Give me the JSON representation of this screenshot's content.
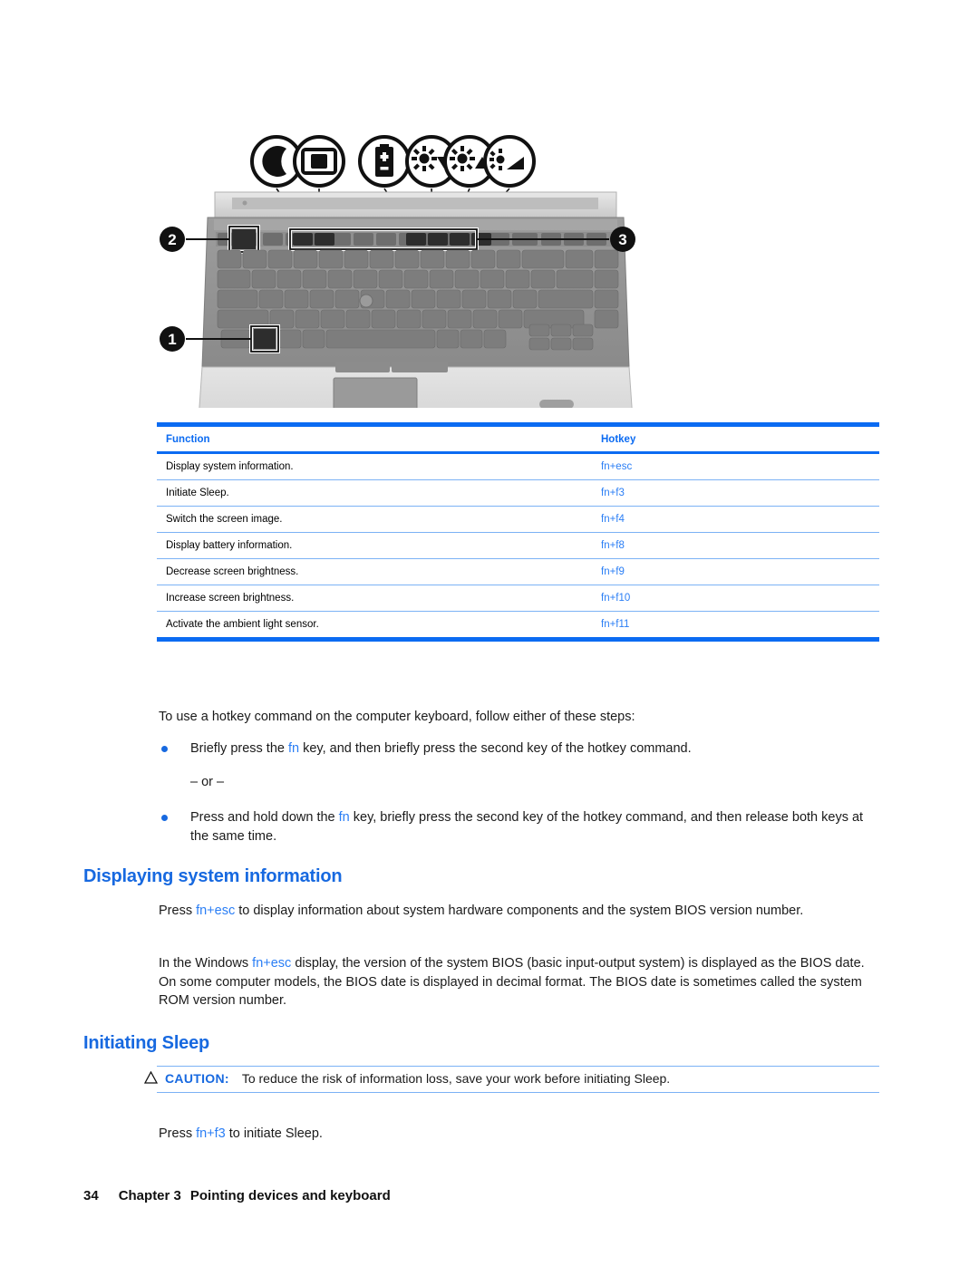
{
  "illustration": {
    "alt": "HP EliteBook notebook top view showing fn key, hotkey function keys and num lock key",
    "callouts": [
      {
        "id": "1",
        "label": "1"
      },
      {
        "id": "2",
        "label": "2"
      },
      {
        "id": "3",
        "label": "3"
      }
    ],
    "icons": [
      {
        "name": "sleep-moon-icon",
        "meaning": "Initiate Sleep"
      },
      {
        "name": "switch-screen-icon",
        "meaning": "Switch the screen image"
      },
      {
        "name": "battery-icon",
        "meaning": "Display battery information"
      },
      {
        "name": "brightness-decrease-icon",
        "meaning": "Decrease screen brightness"
      },
      {
        "name": "brightness-increase-icon",
        "meaning": "Increase screen brightness"
      },
      {
        "name": "ambient-light-sensor-icon",
        "meaning": "Activate the ambient light sensor"
      }
    ]
  },
  "table": {
    "headers": {
      "function": "Function",
      "hotkey": "Hotkey"
    },
    "rows": [
      {
        "function": "Display system information.",
        "hotkey": "fn+esc"
      },
      {
        "function": "Initiate Sleep.",
        "hotkey": "fn+f3"
      },
      {
        "function": "Switch the screen image.",
        "hotkey": "fn+f4"
      },
      {
        "function": "Display battery information.",
        "hotkey": "fn+f8"
      },
      {
        "function": "Decrease screen brightness.",
        "hotkey": "fn+f9"
      },
      {
        "function": "Increase screen brightness.",
        "hotkey": "fn+f10"
      },
      {
        "function": "Activate the ambient light sensor.",
        "hotkey": "fn+f11"
      }
    ]
  },
  "intro": {
    "lead": "To use a hotkey command on the computer keyboard, follow either of these steps:",
    "bullet1_before": "Briefly press the ",
    "bullet1_key": "fn",
    "bullet1_after": " key, and then briefly press the second key of the hotkey command.",
    "or_text": "– or –",
    "bullet2_before": "Press and hold down the ",
    "bullet2_key": "fn",
    "bullet2_after": " key, briefly press the second key of the hotkey command, and then release both keys at the same time."
  },
  "section_display": {
    "heading": "Displaying system information",
    "p1_before": "Press ",
    "p1_key": "fn+esc",
    "p1_after": " to display information about system hardware components and the system BIOS version number.",
    "p2_before": "In the Windows ",
    "p2_key": "fn+esc",
    "p2_after": " display, the version of the system BIOS (basic input-output system) is displayed as the BIOS date. On some computer models, the BIOS date is displayed in decimal format. The BIOS date is sometimes called the system ROM version number."
  },
  "section_sleep": {
    "heading": "Initiating Sleep",
    "caution_label": "CAUTION:",
    "caution_text": "To reduce the risk of information loss, save your work before initiating Sleep.",
    "p1_before": "Press ",
    "p1_key": "fn+f3",
    "p1_after": " to initiate Sleep."
  },
  "footer": {
    "page_number": "34",
    "chapter": "Chapter 3",
    "chapter_title": "Pointing devices and keyboard"
  },
  "colors": {
    "accent_blue": "#1769e0",
    "table_rule_blue": "#0b6bf2",
    "light_rule_blue": "#7cb2f5",
    "key_blue": "#2a7ef5"
  }
}
